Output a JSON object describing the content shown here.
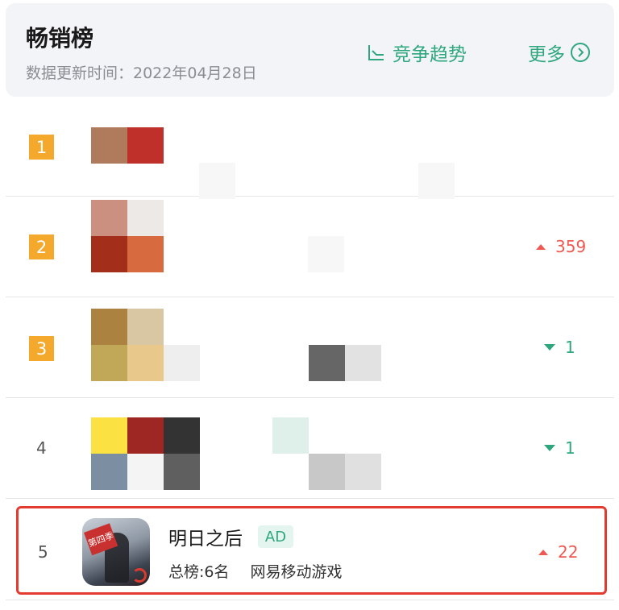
{
  "header": {
    "title": "畅销榜",
    "update_time": "数据更新时间：2022年04月28日",
    "trend_label": "竞争趋势",
    "more_label": "更多"
  },
  "rows": [
    {
      "rank": "1",
      "change": "",
      "change_dir": "none",
      "mosaic": [
        "#b07a5c",
        "#c0302a"
      ]
    },
    {
      "rank": "2",
      "change": "359",
      "change_dir": "up",
      "mosaic": [
        "#cc9080",
        "#ede9e6",
        "#a32f1a",
        "#d76a3e"
      ]
    },
    {
      "rank": "3",
      "change": "1",
      "change_dir": "down",
      "mosaic": [
        "#ac8240",
        "#d9c7a3",
        "#c1a858",
        "#e9c98b"
      ]
    },
    {
      "rank": "4",
      "change": "1",
      "change_dir": "down",
      "mosaic": [
        "#fbe141",
        "#9e2723",
        "#333333",
        "#7b8ea2",
        "#f4f4f4",
        "#5f5f5f"
      ]
    },
    {
      "rank": "5",
      "change": "22",
      "change_dir": "up",
      "name": "明日之后",
      "ad": "AD",
      "total_rank": "总榜:6名",
      "publisher": "网易移动游戏",
      "icon_tag": "第四季"
    }
  ],
  "colors": {
    "accent": "#2fa77e",
    "up": "#ee5a52",
    "rank_badge": "#f4a92c",
    "highlight_border": "#e33b30"
  }
}
